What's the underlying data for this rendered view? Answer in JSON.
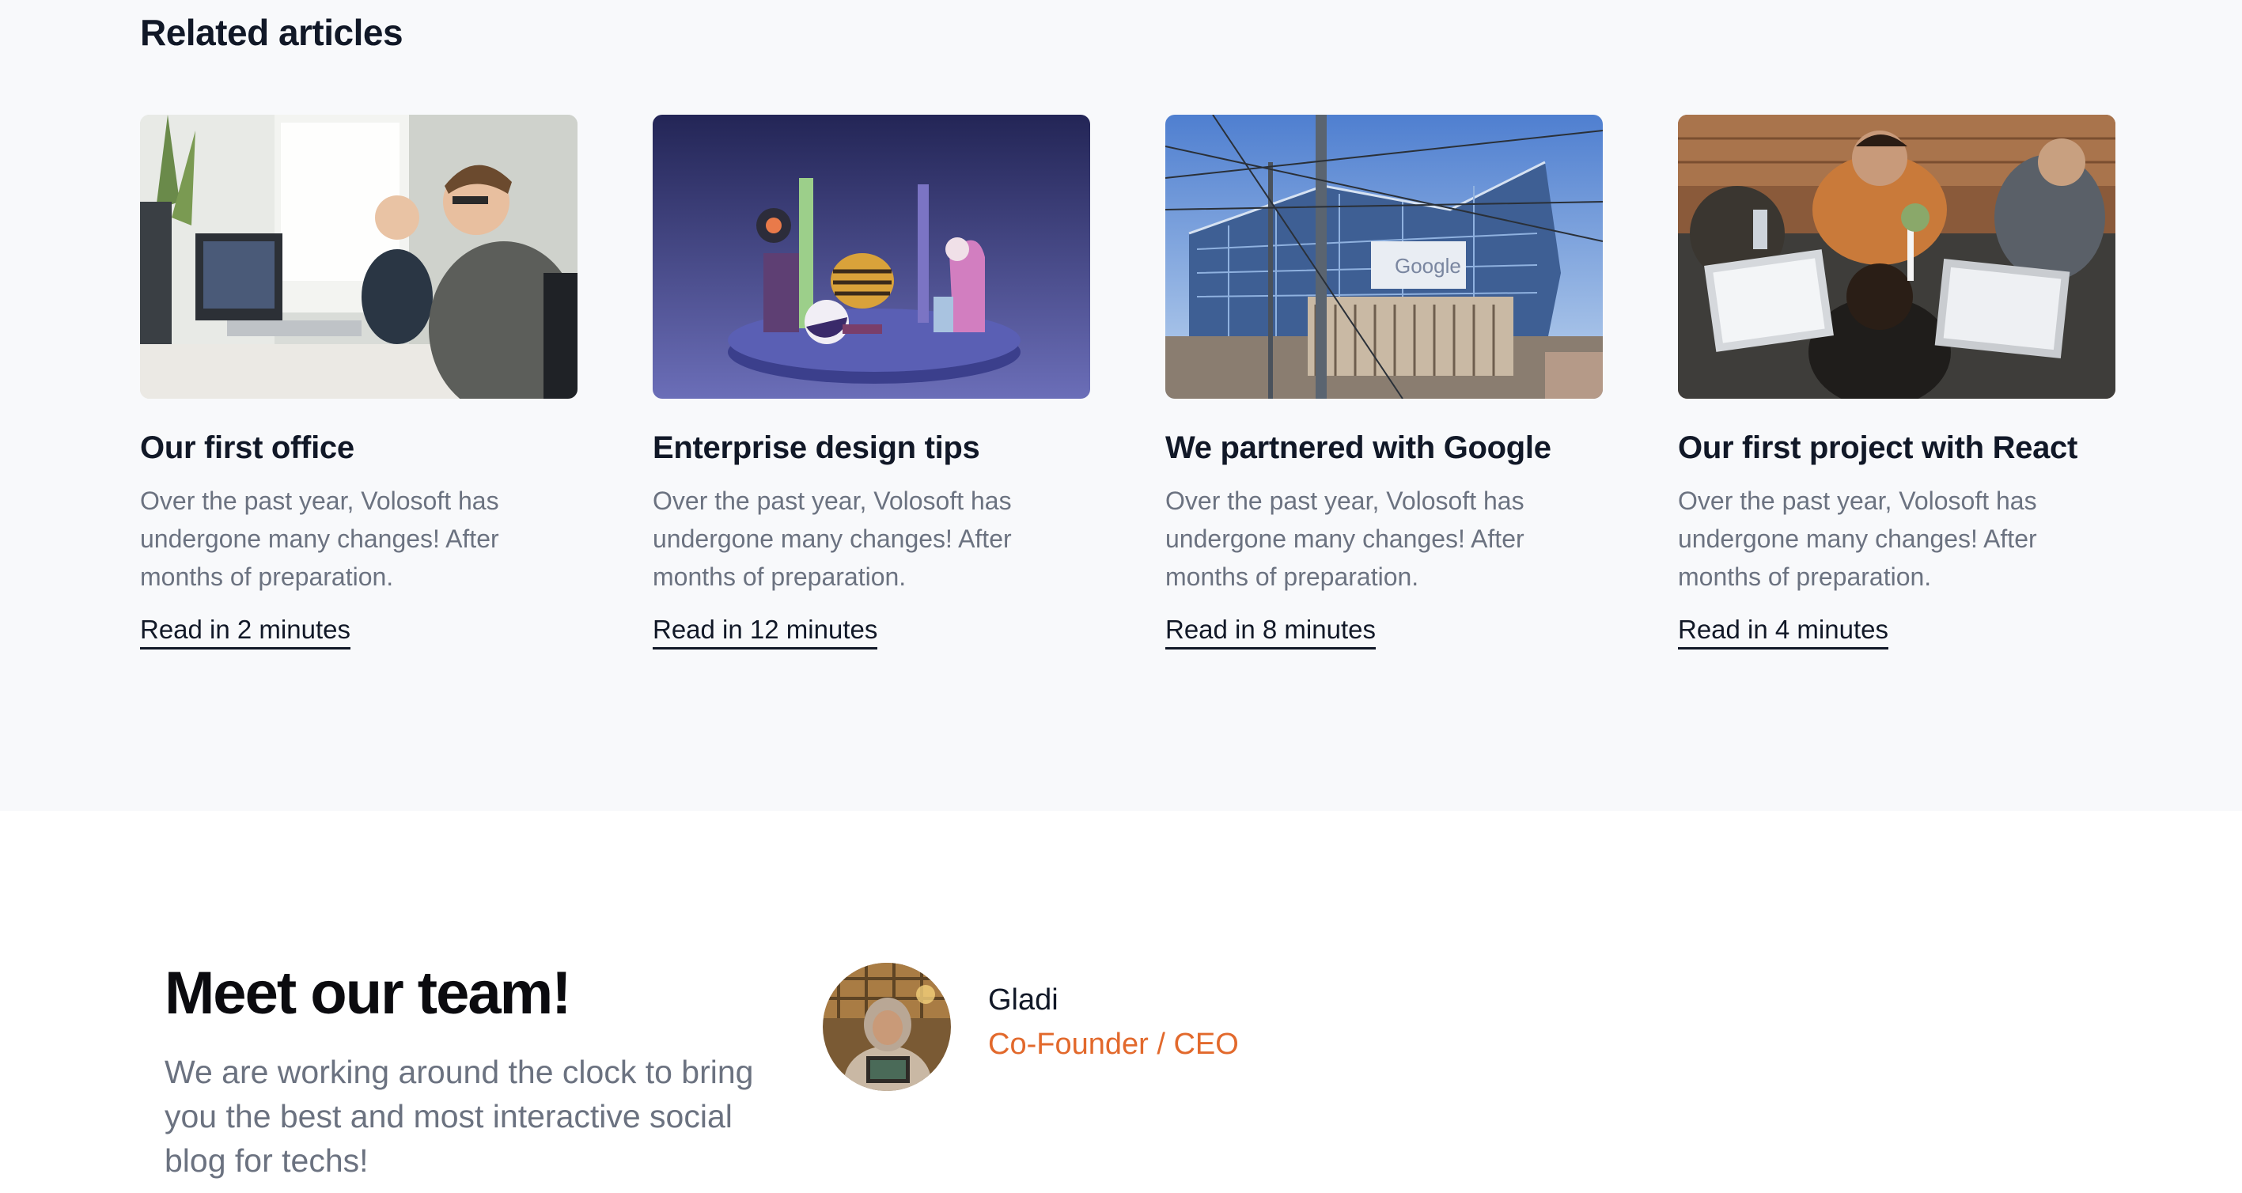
{
  "related": {
    "title": "Related articles",
    "articles": [
      {
        "title": "Our first office",
        "description": "Over the past year, Volosoft has undergone many changes! After months of preparation.",
        "link": "Read in 2 minutes"
      },
      {
        "title": "Enterprise design tips",
        "description": "Over the past year, Volosoft has undergone many changes! After months of preparation.",
        "link": "Read in 12 minutes"
      },
      {
        "title": "We partnered with Google",
        "description": "Over the past year, Volosoft has undergone many changes! After months of preparation.",
        "link": "Read in 8 minutes"
      },
      {
        "title": "Our first project with React",
        "description": "Over the past year, Volosoft has undergone many changes! After months of preparation.",
        "link": "Read in 4 minutes"
      }
    ]
  },
  "team": {
    "heading": "Meet our team!",
    "description": "We are working around the clock to bring you the best and most interactive social blog for techs!",
    "members": [
      {
        "name": "Gladi",
        "role": "Co-Founder / CEO"
      }
    ]
  },
  "colors": {
    "section_bg": "#f8f9fb",
    "heading": "#111827",
    "muted": "#6b7280",
    "role_accent": "#e2692c"
  }
}
